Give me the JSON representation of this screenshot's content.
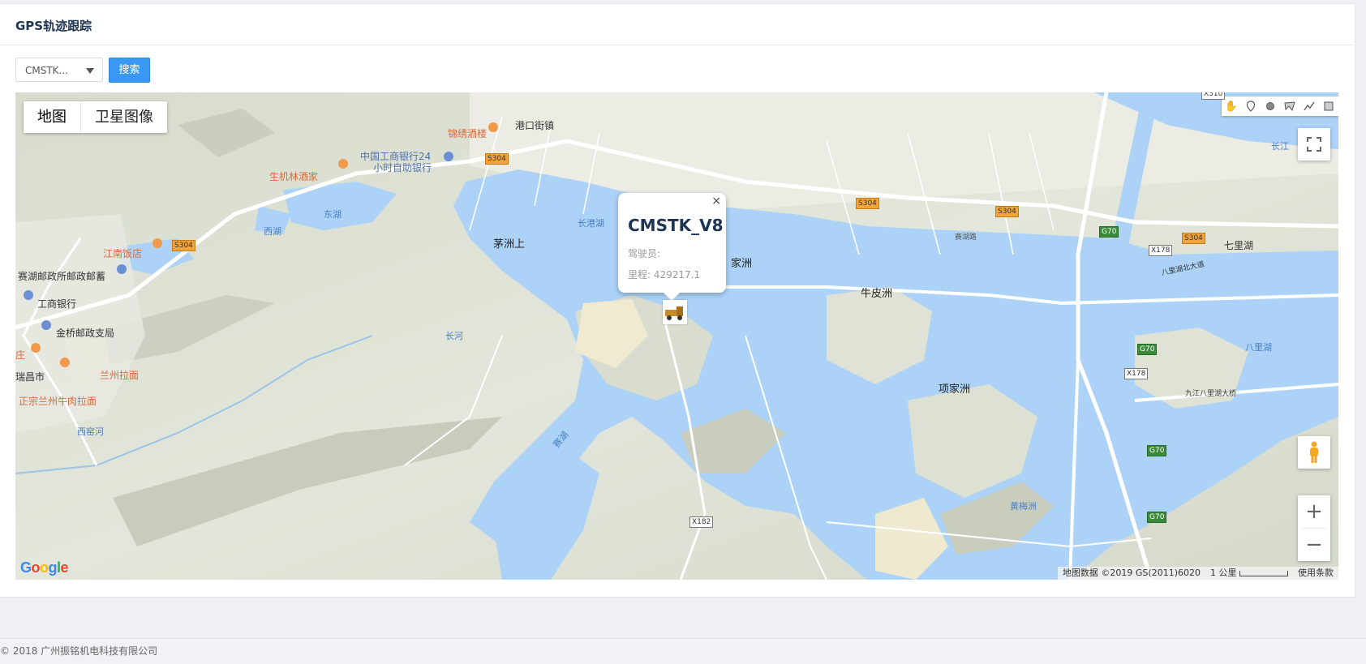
{
  "page": {
    "title": "GPS轨迹跟踪"
  },
  "toolbar": {
    "select_value": "CMSTK...",
    "search_label": "搜索"
  },
  "map": {
    "map_types": [
      "地图",
      "卫星图像"
    ],
    "draw_tools": [
      "hand-icon",
      "marker-icon",
      "circle-icon",
      "polygon-icon",
      "polyline-icon",
      "rectangle-icon"
    ],
    "popup": {
      "title": "CMSTK_V8",
      "driver_label": "驾驶员:",
      "mileage_label": "里程: 429217.1",
      "close": "×"
    },
    "labels": {
      "gangkou": "港口街镇",
      "jinxiu": "锦绣酒楼",
      "icbc24": "中国工商银行24",
      "icbc24b": "小时自助银行",
      "shengjilin": "生机林酒家",
      "donghu": "东湖",
      "xihu": "西湖",
      "jiangnan": "江南饭店",
      "saihu_post": "赛湖邮政所邮政邮蓄",
      "icbc": "工商银行",
      "jinqiao": "金桥邮政支局",
      "lanzhou": "兰州拉面",
      "ruichang": "瑞昌市",
      "zhengzong": "正宗兰州牛肉拉面",
      "xiyao": "西窑河",
      "maozhou": "茅洲上",
      "changgang": "长港湖",
      "jiazhou": "家洲",
      "niupi": "牛皮洲",
      "xiangjia": "项家洲",
      "saihu": "赛湖",
      "changhe": "长河",
      "huangmei": "黄梅洲",
      "qili": "七里湖",
      "bali": "八里湖",
      "changjiang": "长江",
      "bali_bridge": "九江八里湖大桥",
      "bali_road": "八里湖北大道",
      "zhuang": "庄",
      "xixiang": "赛湖路"
    },
    "shields": {
      "s304": "S304",
      "g70": "G70",
      "x178": "X178",
      "x182": "X182",
      "x310": "X310"
    },
    "logo": "Google",
    "attribution": "地图数据 ©2019 GS(2011)6020",
    "scale": "1 公里",
    "terms": "使用条款"
  },
  "footer": {
    "copyright": "© 2018 广州振铭机电科技有限公司"
  }
}
